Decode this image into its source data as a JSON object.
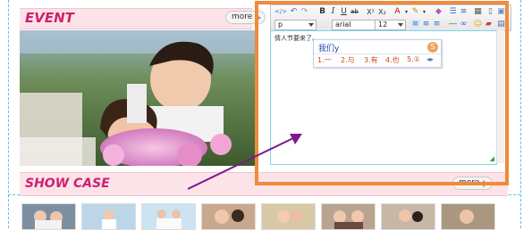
{
  "event_section": {
    "title": "EVENT",
    "more_label": "more"
  },
  "showcase_section": {
    "title": "SHOW CASE",
    "more_label": "more"
  },
  "toolbar": {
    "paragraph_value": "p",
    "font_value": "arial",
    "size_value": "12"
  },
  "editor": {
    "content_text": "情人节要来了。",
    "ime_input": "我们y",
    "ime_candidates": [
      "1.一",
      "2.与",
      "3.有",
      "4.也",
      "5.①"
    ]
  },
  "colors": {
    "accent": "#d11f6e",
    "highlight_box": "#f08a3c",
    "dashed_guides": "#58c3e6",
    "arrow": "#7a1a8c"
  }
}
